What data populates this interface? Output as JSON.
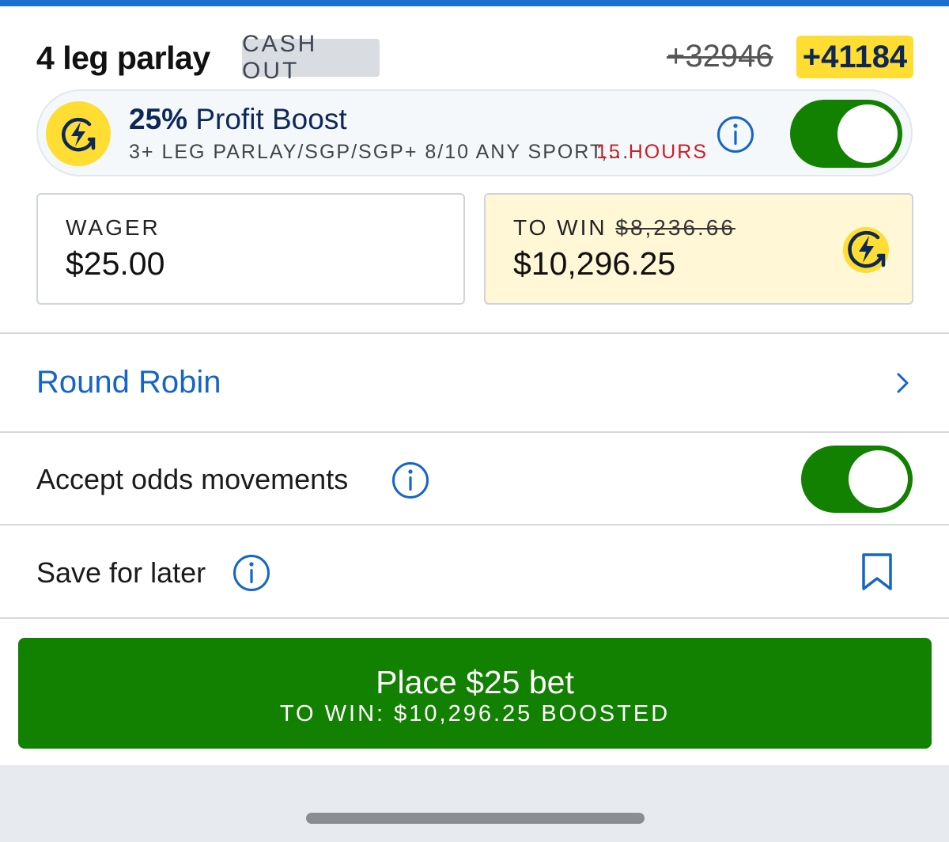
{
  "header": {
    "title": "4 leg parlay",
    "cash_out_label": "CASH OUT",
    "odds_original": "+32946",
    "odds_boosted": "+41184"
  },
  "boost": {
    "percent": "25%",
    "title_suffix": "Profit Boost",
    "description": "3+ LEG PARLAY/SGP/SGP+ 8/10 ANY SPORT,...",
    "expires": "15 HOURS",
    "enabled": true
  },
  "wager": {
    "label": "WAGER",
    "value": "$25.00"
  },
  "to_win": {
    "label": "TO WIN",
    "original_value": "$8,236.66",
    "value": "$10,296.25"
  },
  "round_robin": {
    "label": "Round Robin"
  },
  "accept_odds": {
    "label": "Accept odds movements",
    "enabled": true
  },
  "save_for_later": {
    "label": "Save for later"
  },
  "place_bet": {
    "label": "Place $25 bet",
    "sublabel": "TO WIN: $10,296.25 BOOSTED"
  },
  "colors": {
    "accent_blue": "#1a6fd1",
    "link_blue": "#1565c8",
    "green": "#128000",
    "boost_yellow": "#ffdd33",
    "navy": "#0d2856",
    "alert_red": "#c8202a"
  },
  "icons": {
    "boost": "lightning-bolt-icon",
    "info": "info-icon",
    "chevron": "chevron-right-icon",
    "bookmark": "bookmark-icon"
  }
}
